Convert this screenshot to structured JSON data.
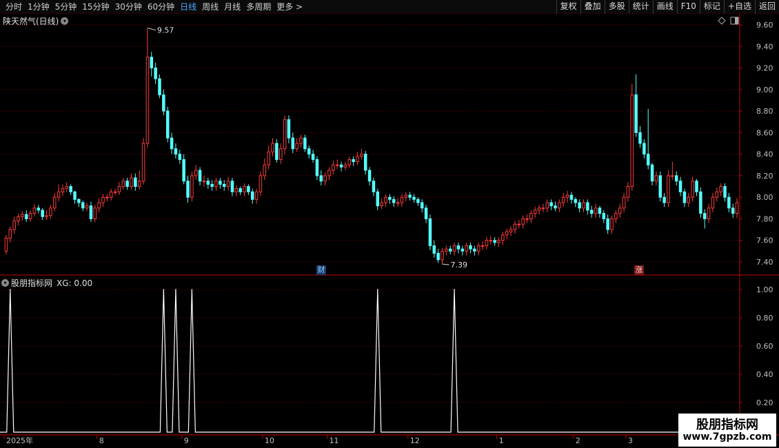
{
  "toolbar": {
    "tabs": [
      "分时",
      "1分钟",
      "5分钟",
      "15分钟",
      "30分钟",
      "60分钟",
      "日线",
      "周线",
      "月线",
      "多周期",
      "更多 >"
    ],
    "active_tab": "日线",
    "right_tools": [
      "复权",
      "叠加",
      "多股",
      "统计",
      "画线",
      "F10",
      "标记",
      "+自选",
      "返回"
    ]
  },
  "main_panel": {
    "title": "陕天然气(日线)",
    "high_label": "9.57",
    "low_label": "7.39",
    "marker_cai": "财",
    "marker_zhang": "涨"
  },
  "indicator_panel": {
    "title": "股朋指标网",
    "formula": "XG: 0.00"
  },
  "x_axis": {
    "labels": [
      {
        "text": "2025年",
        "idx": 0
      },
      {
        "text": "8",
        "idx": 23
      },
      {
        "text": "9",
        "idx": 44
      },
      {
        "text": "10",
        "idx": 64
      },
      {
        "text": "11",
        "idx": 80
      },
      {
        "text": "12",
        "idx": 100
      },
      {
        "text": "1",
        "idx": 122
      },
      {
        "text": "2",
        "idx": 141
      },
      {
        "text": "3",
        "idx": 154
      }
    ]
  },
  "watermark": {
    "title": "股朋指标网",
    "url": "www.7gpzb.com"
  },
  "colors": {
    "up": "#ff3b3b",
    "down": "#54ffff",
    "grid": "#8b0000",
    "axis": "#c00000",
    "text": "#c0c0c0",
    "indicator_line": "#ffffff"
  },
  "chart_data": [
    {
      "type": "candlestick",
      "title": "陕天然气(日线)",
      "ylim": [
        7.3,
        9.7
      ],
      "yticks": [
        7.4,
        7.6,
        7.8,
        8.0,
        8.2,
        8.4,
        8.6,
        8.8,
        9.0,
        9.2,
        9.4,
        9.6
      ],
      "ytick_labels": [
        "7.40",
        "7.60",
        "7.80",
        "8.00",
        "8.20",
        "8.40",
        "8.60",
        "8.80",
        "9.00",
        "9.20",
        "9.40",
        "9.60"
      ],
      "x": [
        0,
        1,
        2,
        3,
        4,
        5,
        6,
        7,
        8,
        9,
        10,
        11,
        12,
        13,
        14,
        15,
        16,
        17,
        18,
        19,
        20,
        21,
        22,
        23,
        24,
        25,
        26,
        27,
        28,
        29,
        30,
        31,
        32,
        33,
        34,
        35,
        36,
        37,
        38,
        39,
        40,
        41,
        42,
        43,
        44,
        45,
        46,
        47,
        48,
        49,
        50,
        51,
        52,
        53,
        54,
        55,
        56,
        57,
        58,
        59,
        60,
        61,
        62,
        63,
        64,
        65,
        66,
        67,
        68,
        69,
        70,
        71,
        72,
        73,
        74,
        75,
        76,
        77,
        78,
        79,
        80,
        81,
        82,
        83,
        84,
        85,
        86,
        87,
        88,
        89,
        90,
        91,
        92,
        93,
        94,
        95,
        96,
        97,
        98,
        99,
        100,
        101,
        102,
        103,
        104,
        105,
        106,
        107,
        108,
        109,
        110,
        111,
        112,
        113,
        114,
        115,
        116,
        117,
        118,
        119,
        120,
        121,
        122,
        123,
        124,
        125,
        126,
        127,
        128,
        129,
        130,
        131,
        132,
        133,
        134,
        135,
        136,
        137,
        138,
        139,
        140,
        141,
        142,
        143,
        144,
        145,
        146,
        147,
        148,
        149,
        150,
        151,
        152,
        153,
        154,
        155,
        156,
        157,
        158,
        159,
        160,
        161,
        162,
        163,
        164,
        165,
        166,
        167,
        168,
        169,
        170,
        171,
        172,
        173,
        174,
        175,
        176,
        177,
        178,
        179,
        180
      ],
      "open": [
        7.5,
        7.62,
        7.7,
        7.78,
        7.82,
        7.84,
        7.8,
        7.85,
        7.9,
        7.88,
        7.82,
        7.83,
        7.9,
        8.0,
        8.05,
        8.08,
        8.1,
        8.05,
        7.98,
        7.95,
        7.9,
        7.92,
        7.8,
        7.9,
        7.95,
        8.0,
        8.0,
        8.05,
        8.05,
        8.1,
        8.15,
        8.1,
        8.18,
        8.1,
        8.15,
        8.5,
        9.3,
        9.2,
        9.1,
        8.95,
        8.8,
        8.55,
        8.45,
        8.4,
        8.35,
        8.15,
        8.0,
        8.2,
        8.25,
        8.15,
        8.15,
        8.12,
        8.1,
        8.15,
        8.12,
        8.1,
        8.15,
        8.05,
        8.08,
        8.05,
        8.1,
        8.05,
        7.98,
        8.05,
        8.2,
        8.3,
        8.42,
        8.5,
        8.35,
        8.45,
        8.72,
        8.55,
        8.45,
        8.5,
        8.55,
        8.45,
        8.4,
        8.35,
        8.2,
        8.15,
        8.2,
        8.25,
        8.3,
        8.3,
        8.28,
        8.3,
        8.35,
        8.33,
        8.38,
        8.4,
        8.25,
        8.15,
        8.05,
        7.92,
        7.95,
        8.0,
        7.98,
        7.95,
        7.95,
        8.0,
        8.02,
        8.0,
        7.98,
        7.95,
        7.9,
        7.8,
        7.55,
        7.48,
        7.42,
        7.5,
        7.52,
        7.5,
        7.55,
        7.52,
        7.5,
        7.55,
        7.52,
        7.5,
        7.55,
        7.55,
        7.6,
        7.6,
        7.58,
        7.6,
        7.65,
        7.68,
        7.7,
        7.75,
        7.75,
        7.8,
        7.8,
        7.85,
        7.88,
        7.9,
        7.9,
        7.95,
        7.92,
        7.9,
        7.95,
        8.0,
        8.02,
        7.98,
        7.95,
        7.9,
        7.95,
        7.88,
        7.85,
        7.9,
        7.85,
        7.8,
        7.7,
        7.8,
        7.85,
        7.9,
        8.0,
        8.1,
        8.95,
        8.6,
        8.5,
        8.4,
        8.3,
        8.15,
        8.2,
        8.0,
        7.95,
        8.2,
        8.2,
        8.15,
        8.05,
        7.95,
        8.0,
        8.15,
        8.05,
        7.85,
        7.8,
        7.9,
        8.0,
        8.05,
        8.1,
        8.0,
        7.9,
        7.85
      ],
      "close": [
        7.62,
        7.7,
        7.78,
        7.82,
        7.84,
        7.8,
        7.85,
        7.9,
        7.88,
        7.82,
        7.83,
        7.9,
        8.0,
        8.05,
        8.08,
        8.1,
        8.05,
        7.98,
        7.95,
        7.9,
        7.92,
        7.8,
        7.9,
        7.95,
        8.0,
        8.0,
        8.05,
        8.05,
        8.1,
        8.15,
        8.1,
        8.18,
        8.1,
        8.15,
        8.5,
        9.3,
        9.2,
        9.1,
        8.95,
        8.8,
        8.55,
        8.45,
        8.4,
        8.35,
        8.15,
        8.0,
        8.2,
        8.25,
        8.15,
        8.15,
        8.12,
        8.1,
        8.15,
        8.12,
        8.1,
        8.15,
        8.05,
        8.08,
        8.05,
        8.1,
        8.05,
        7.98,
        8.05,
        8.2,
        8.3,
        8.42,
        8.5,
        8.35,
        8.45,
        8.72,
        8.55,
        8.45,
        8.5,
        8.55,
        8.45,
        8.4,
        8.35,
        8.2,
        8.15,
        8.2,
        8.25,
        8.3,
        8.3,
        8.28,
        8.3,
        8.35,
        8.33,
        8.38,
        8.4,
        8.25,
        8.15,
        8.05,
        7.92,
        7.95,
        8.0,
        7.98,
        7.95,
        7.95,
        8.0,
        8.02,
        8.0,
        7.98,
        7.95,
        7.9,
        7.8,
        7.55,
        7.48,
        7.42,
        7.5,
        7.52,
        7.5,
        7.55,
        7.52,
        7.5,
        7.55,
        7.52,
        7.5,
        7.55,
        7.55,
        7.6,
        7.6,
        7.58,
        7.6,
        7.65,
        7.68,
        7.7,
        7.75,
        7.75,
        7.8,
        7.8,
        7.85,
        7.88,
        7.9,
        7.9,
        7.95,
        7.92,
        7.9,
        7.95,
        8.0,
        8.02,
        7.98,
        7.95,
        7.9,
        7.95,
        7.88,
        7.85,
        7.9,
        7.85,
        7.8,
        7.7,
        7.8,
        7.85,
        7.9,
        8.0,
        8.1,
        8.95,
        8.6,
        8.5,
        8.4,
        8.3,
        8.15,
        8.2,
        8.0,
        7.95,
        8.2,
        8.2,
        8.15,
        8.05,
        7.95,
        8.0,
        8.15,
        8.05,
        7.85,
        7.8,
        7.9,
        8.0,
        8.05,
        8.1,
        8.0,
        7.9,
        7.85,
        7.95
      ],
      "high": [
        7.65,
        7.73,
        7.82,
        7.85,
        7.87,
        7.88,
        7.88,
        7.94,
        7.93,
        7.9,
        7.88,
        7.93,
        8.04,
        8.12,
        8.12,
        8.14,
        8.12,
        8.06,
        7.99,
        7.97,
        7.95,
        7.96,
        7.93,
        7.99,
        8.03,
        8.03,
        8.08,
        8.08,
        8.14,
        8.18,
        8.18,
        8.22,
        8.22,
        8.25,
        8.55,
        9.57,
        9.35,
        9.25,
        9.14,
        9.0,
        8.84,
        8.6,
        8.5,
        8.44,
        8.4,
        8.2,
        8.24,
        8.3,
        8.28,
        8.2,
        8.18,
        8.16,
        8.18,
        8.18,
        8.16,
        8.19,
        8.18,
        8.11,
        8.1,
        8.13,
        8.12,
        8.08,
        8.08,
        8.24,
        8.36,
        8.48,
        8.55,
        8.54,
        8.5,
        8.76,
        8.76,
        8.6,
        8.55,
        8.58,
        8.58,
        8.48,
        8.44,
        8.38,
        8.25,
        8.23,
        8.28,
        8.34,
        8.35,
        8.33,
        8.33,
        8.38,
        8.38,
        8.42,
        8.45,
        8.43,
        8.28,
        8.18,
        8.08,
        7.99,
        8.03,
        8.03,
        8.01,
        7.99,
        8.03,
        8.05,
        8.05,
        8.03,
        8.0,
        7.98,
        7.93,
        7.84,
        7.6,
        7.52,
        7.53,
        7.55,
        7.55,
        7.58,
        7.58,
        7.55,
        7.58,
        7.58,
        7.55,
        7.58,
        7.59,
        7.63,
        7.64,
        7.63,
        7.63,
        7.68,
        7.71,
        7.73,
        7.78,
        7.79,
        7.83,
        7.84,
        7.88,
        7.91,
        7.93,
        7.94,
        7.98,
        7.98,
        7.96,
        7.98,
        8.04,
        8.06,
        8.05,
        8.0,
        7.98,
        7.98,
        7.98,
        7.92,
        7.94,
        7.92,
        7.88,
        7.84,
        7.83,
        7.88,
        7.94,
        8.04,
        8.14,
        9.05,
        9.14,
        8.66,
        8.54,
        8.82,
        8.32,
        8.24,
        8.24,
        8.04,
        8.25,
        8.33,
        8.24,
        8.19,
        8.08,
        8.04,
        8.19,
        8.17,
        8.09,
        7.89,
        7.94,
        8.04,
        8.09,
        8.13,
        8.13,
        8.04,
        7.94,
        7.99
      ],
      "low": [
        7.47,
        7.58,
        7.66,
        7.74,
        7.78,
        7.77,
        7.77,
        7.82,
        7.85,
        7.79,
        7.79,
        7.8,
        7.87,
        7.96,
        8.01,
        8.05,
        8.02,
        7.94,
        7.91,
        7.87,
        7.87,
        7.77,
        7.77,
        7.86,
        7.91,
        7.96,
        7.97,
        8.02,
        8.02,
        8.07,
        8.07,
        8.07,
        8.06,
        8.07,
        8.12,
        8.46,
        9.12,
        9.05,
        8.92,
        8.76,
        8.51,
        8.4,
        8.36,
        8.31,
        8.12,
        7.95,
        7.96,
        8.16,
        8.11,
        8.1,
        8.08,
        8.06,
        8.06,
        8.08,
        8.06,
        8.06,
        8.01,
        8.01,
        8.02,
        8.01,
        8.02,
        7.94,
        7.94,
        8.01,
        8.16,
        8.26,
        8.38,
        8.32,
        8.31,
        8.4,
        8.5,
        8.41,
        8.42,
        8.46,
        8.42,
        8.36,
        8.32,
        8.16,
        8.11,
        8.11,
        8.16,
        8.21,
        8.26,
        8.24,
        8.25,
        8.27,
        8.29,
        8.3,
        8.35,
        8.21,
        8.11,
        8.01,
        7.88,
        7.89,
        7.91,
        7.94,
        7.91,
        7.91,
        7.91,
        7.96,
        7.97,
        7.95,
        7.92,
        7.86,
        7.76,
        7.51,
        7.44,
        7.39,
        7.38,
        7.46,
        7.47,
        7.46,
        7.48,
        7.46,
        7.46,
        7.48,
        7.46,
        7.46,
        7.51,
        7.52,
        7.56,
        7.55,
        7.54,
        7.56,
        7.61,
        7.64,
        7.66,
        7.71,
        7.71,
        7.76,
        7.76,
        7.81,
        7.84,
        7.86,
        7.86,
        7.88,
        7.87,
        7.86,
        7.91,
        7.95,
        7.94,
        7.91,
        7.86,
        7.86,
        7.84,
        7.81,
        7.81,
        7.81,
        7.76,
        7.66,
        7.66,
        7.76,
        7.81,
        7.86,
        7.96,
        8.06,
        8.56,
        8.46,
        8.36,
        8.26,
        8.11,
        8.11,
        7.96,
        7.91,
        7.91,
        8.16,
        8.11,
        8.01,
        7.91,
        7.91,
        7.96,
        8.01,
        7.81,
        7.71,
        7.76,
        7.86,
        7.96,
        8.01,
        7.96,
        7.86,
        7.81,
        7.81
      ]
    },
    {
      "type": "line",
      "title": "股朋指标网",
      "ylim": [
        0.1,
        1.05
      ],
      "yticks": [
        0.2,
        0.4,
        0.6,
        0.8,
        1.0
      ],
      "ytick_labels": [
        "0.20",
        "0.40",
        "0.60",
        "0.80",
        "1.00"
      ],
      "series": [
        {
          "name": "XG",
          "spike_idx": [
            1,
            39,
            42,
            46,
            92,
            111
          ],
          "spike_value": 1.0,
          "base_value": 0.0
        }
      ]
    }
  ]
}
